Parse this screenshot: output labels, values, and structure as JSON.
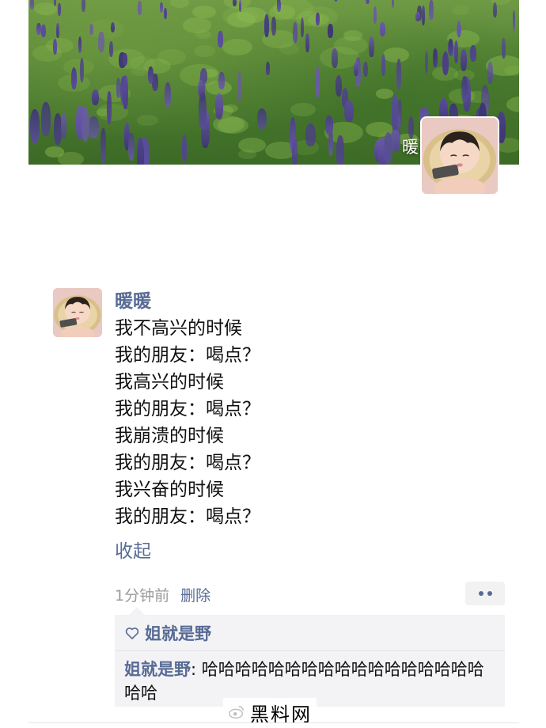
{
  "cover": {
    "user_name": "暖暖"
  },
  "post": {
    "author": "暖暖",
    "lines": [
      "我不高兴的时候",
      "我的朋友：喝点？",
      "我高兴的时候",
      "我的朋友：喝点？",
      "我崩溃的时候",
      "我的朋友：喝点？",
      "我兴奋的时候",
      "我的朋友：喝点？"
    ],
    "collapse_label": "收起",
    "time": "1分钟前",
    "delete_label": "删除"
  },
  "interaction": {
    "likes": [
      "姐就是野"
    ],
    "comments": [
      {
        "author": "姐就是野",
        "separator": ": ",
        "text": "哈哈哈哈哈哈哈哈哈哈哈哈哈哈哈哈哈哈哈"
      }
    ]
  },
  "watermark": {
    "text": "黑料网"
  },
  "colors": {
    "link_blue": "#576b95",
    "meta_gray": "#9b9b9b",
    "comment_bg": "#f3f3f5"
  },
  "icons": {
    "like": "heart-outline-icon",
    "more": "more-dots-icon"
  }
}
